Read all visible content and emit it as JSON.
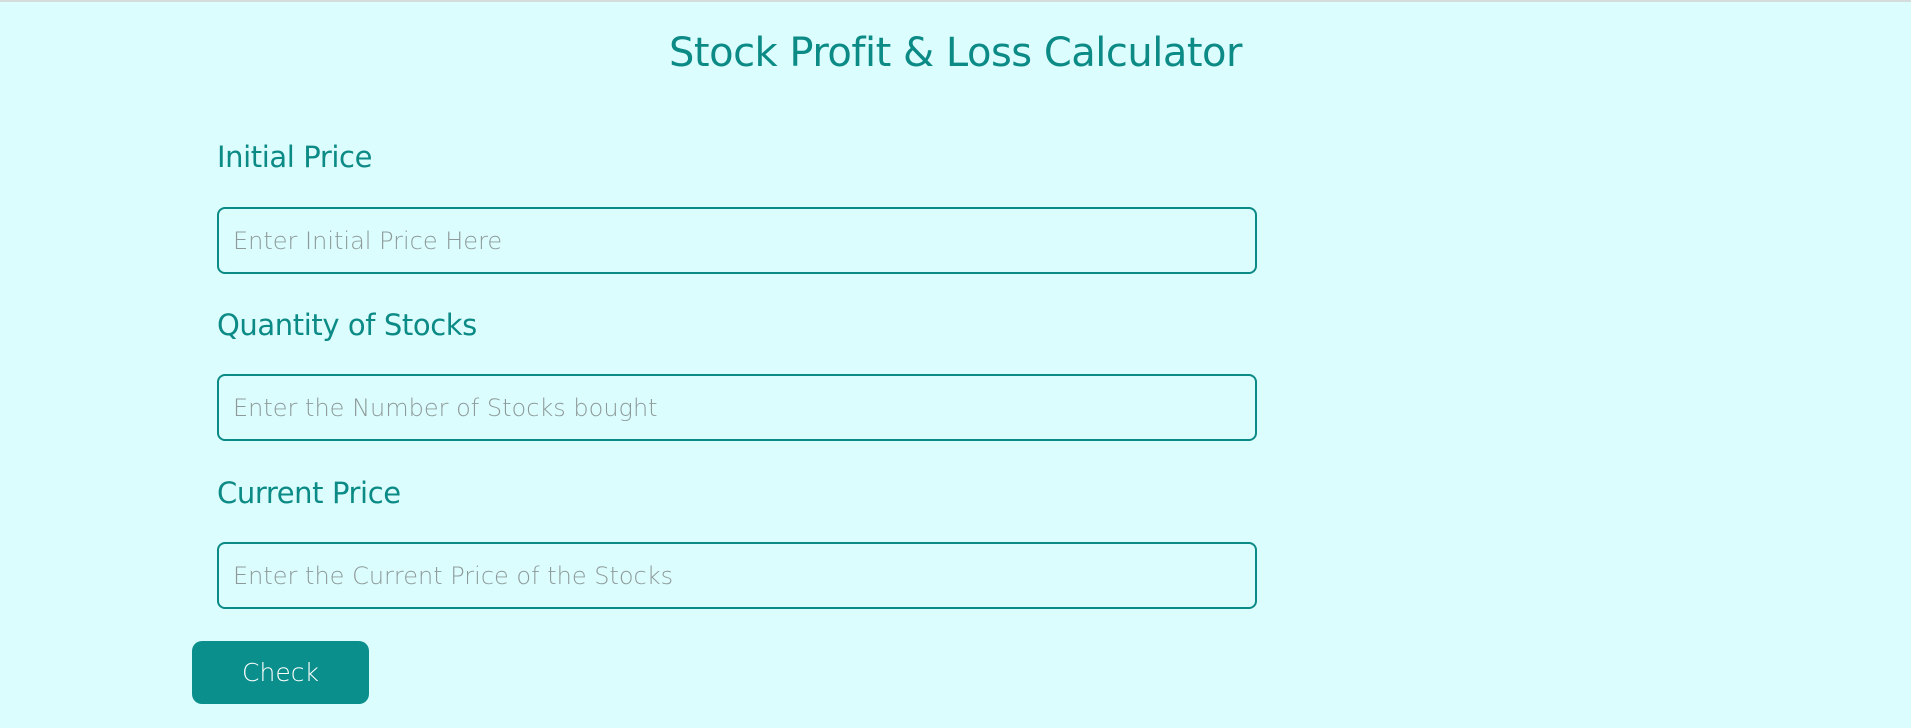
{
  "header": {
    "title": "Stock Profit & Loss Calculator"
  },
  "form": {
    "initial_price": {
      "label": "Initial Price",
      "placeholder": "Enter Initial Price Here",
      "value": ""
    },
    "quantity": {
      "label": "Quantity of Stocks",
      "placeholder": "Enter the Number of Stocks bought",
      "value": ""
    },
    "current_price": {
      "label": "Current Price",
      "placeholder": "Enter the Current Price of the Stocks",
      "value": ""
    },
    "submit_label": "Check"
  },
  "colors": {
    "background": "#dcfdfd",
    "accent": "#0b8a86",
    "button": "#0b8f8c",
    "placeholder": "#8e9a9a"
  }
}
